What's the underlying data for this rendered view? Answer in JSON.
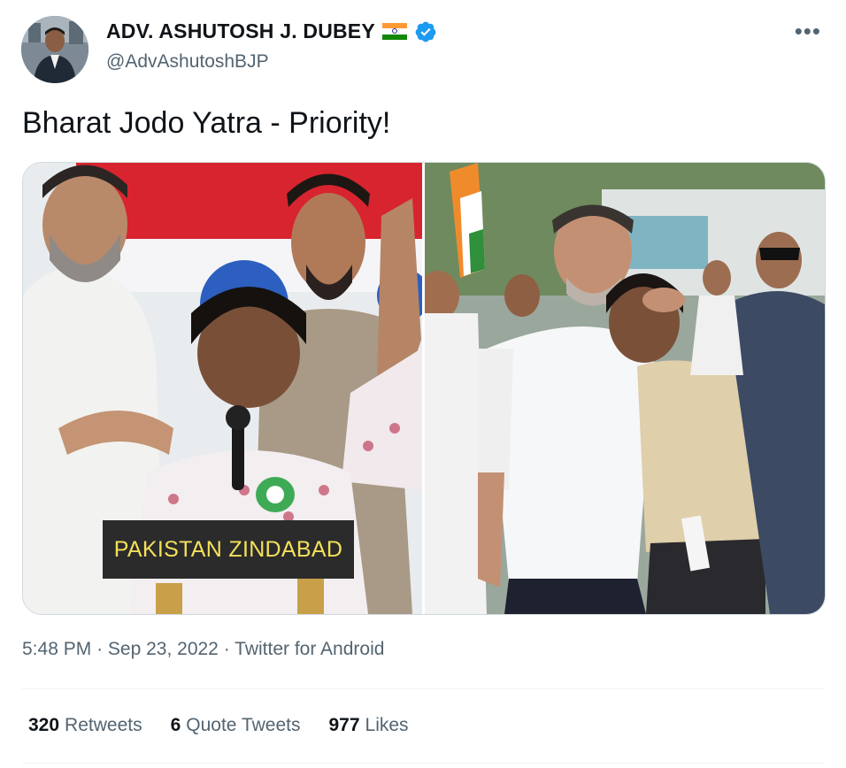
{
  "author": {
    "display_name": "ADV. ASHUTOSH J. DUBEY",
    "handle": "@AdvAshutoshBJP",
    "flag_icon": "india-flag-icon",
    "verified_icon": "verified-badge-icon",
    "verified_color": "#1d9bf0"
  },
  "tweet": {
    "text": "Bharat Jodo Yatra - Priority!",
    "media_caption": "PAKISTAN ZINDABAD",
    "time": "5:48 PM",
    "date": "Sep 23, 2022",
    "source": "Twitter for Android",
    "dot": "·"
  },
  "menu": {
    "more_label": "•••"
  },
  "stats": {
    "retweets_count": "320",
    "retweets_label": "Retweets",
    "quotes_count": "6",
    "quotes_label": "Quote Tweets",
    "likes_count": "977",
    "likes_label": "Likes"
  }
}
